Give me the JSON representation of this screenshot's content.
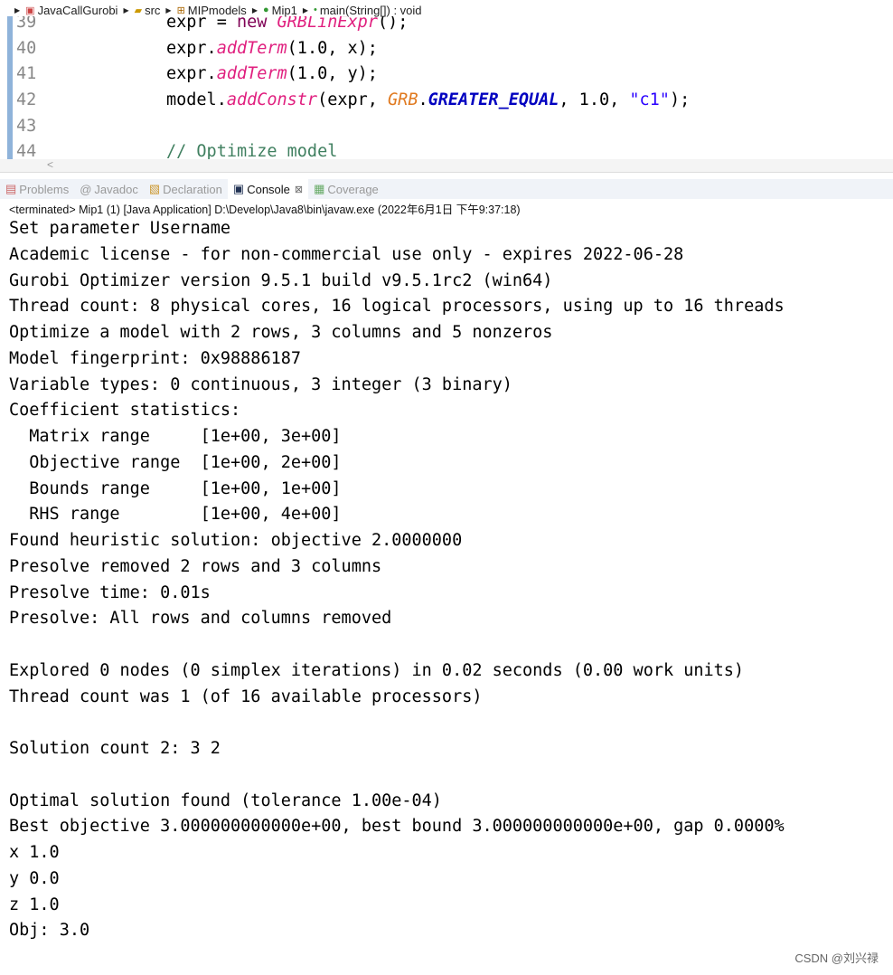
{
  "breadcrumb": [
    {
      "label": "JavaCallGurobi",
      "icon": "project-icon"
    },
    {
      "label": "src",
      "icon": "folder-icon"
    },
    {
      "label": "MIPmodels",
      "icon": "package-icon"
    },
    {
      "label": "Mip1",
      "icon": "class-icon"
    },
    {
      "label": "main(String[]) : void",
      "icon": "method-icon"
    }
  ],
  "code": {
    "line_numbers": [
      "39",
      "40",
      "41",
      "42",
      "43",
      "44"
    ],
    "l39a": "expr = ",
    "l39b": "new ",
    "l39c": "GRBLinExpr",
    "l39d": "();",
    "l40a": "expr.",
    "l40b": "addTerm",
    "l40c": "(1.0, x);",
    "l41a": "expr.",
    "l41b": "addTerm",
    "l41c": "(1.0, y);",
    "l42a": "model.",
    "l42b": "addConstr",
    "l42c": "(expr, ",
    "l42d": "GRB",
    "l42e": ".",
    "l42f": "GREATER_EQUAL",
    "l42g": ", 1.0, ",
    "l42h": "\"c1\"",
    "l42i": ");",
    "l44": "// Optimize model"
  },
  "scroll_arrow": "<",
  "tabs": [
    {
      "label": "Problems",
      "icon": "problems-icon"
    },
    {
      "label": "Javadoc",
      "icon": "javadoc-icon"
    },
    {
      "label": "Declaration",
      "icon": "declaration-icon"
    },
    {
      "label": "Console",
      "icon": "console-icon",
      "active": true,
      "close": "⊠"
    },
    {
      "label": "Coverage",
      "icon": "coverage-icon"
    }
  ],
  "terminated": "<terminated> Mip1 (1) [Java Application] D:\\Develop\\Java8\\bin\\javaw.exe (2022年6月1日 下午9:37:18)",
  "console_lines": [
    "Set parameter Username",
    "Academic license - for non-commercial use only - expires 2022-06-28",
    "Gurobi Optimizer version 9.5.1 build v9.5.1rc2 (win64)",
    "Thread count: 8 physical cores, 16 logical processors, using up to 16 threads",
    "Optimize a model with 2 rows, 3 columns and 5 nonzeros",
    "Model fingerprint: 0x98886187",
    "Variable types: 0 continuous, 3 integer (3 binary)",
    "Coefficient statistics:",
    "  Matrix range     [1e+00, 3e+00]",
    "  Objective range  [1e+00, 2e+00]",
    "  Bounds range     [1e+00, 1e+00]",
    "  RHS range        [1e+00, 4e+00]",
    "Found heuristic solution: objective 2.0000000",
    "Presolve removed 2 rows and 3 columns",
    "Presolve time: 0.01s",
    "Presolve: All rows and columns removed",
    "",
    "Explored 0 nodes (0 simplex iterations) in 0.02 seconds (0.00 work units)",
    "Thread count was 1 (of 16 available processors)",
    "",
    "Solution count 2: 3 2",
    "",
    "Optimal solution found (tolerance 1.00e-04)",
    "Best objective 3.000000000000e+00, best bound 3.000000000000e+00, gap 0.0000%",
    "x 1.0",
    "y 0.0",
    "z 1.0",
    "Obj: 3.0"
  ],
  "watermark": "CSDN @刘兴禄"
}
